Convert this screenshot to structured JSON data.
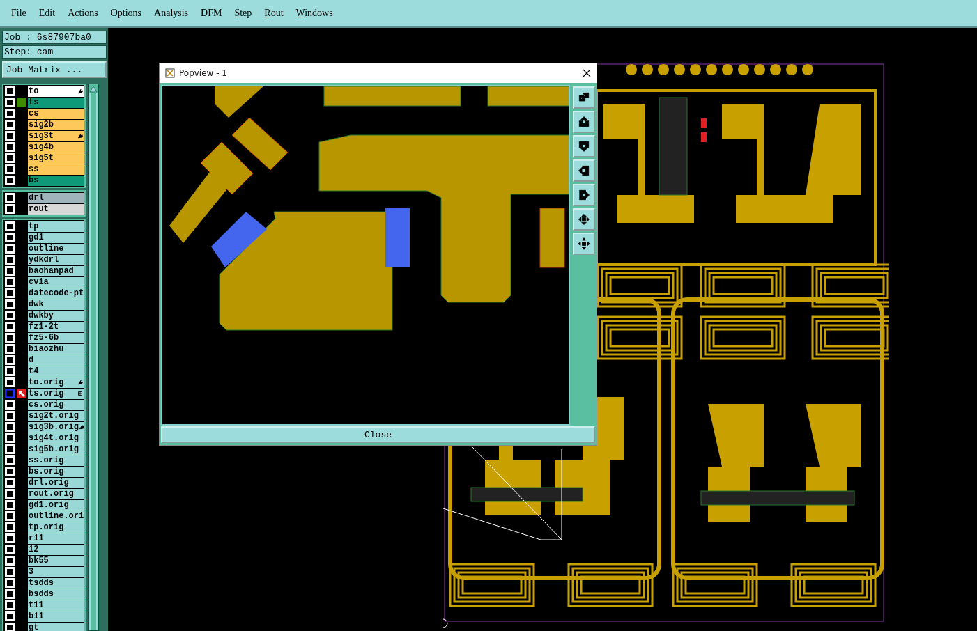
{
  "menu": [
    {
      "label": "File",
      "mnemonic": true
    },
    {
      "label": "Edit",
      "mnemonic": true
    },
    {
      "label": "Actions",
      "mnemonic": true
    },
    {
      "label": "Options",
      "mnemonic": false
    },
    {
      "label": "Analysis",
      "mnemonic": false
    },
    {
      "label": "DFM",
      "mnemonic": false
    },
    {
      "label": "Step",
      "mnemonic": true
    },
    {
      "label": "Rout",
      "mnemonic": true
    },
    {
      "label": "Windows",
      "mnemonic": true
    }
  ],
  "job": "Job : 6s87907ba0",
  "step": "Step: cam",
  "job_matrix_button": "Job Matrix ...",
  "layer_groups": [
    {
      "layers": [
        {
          "name": "to",
          "color": "#ffffff",
          "affected": true,
          "displayed": false,
          "work_layer": false
        },
        {
          "name": "ts",
          "color": "#0e9a78",
          "affected": false,
          "displayed": true,
          "work_layer": false
        },
        {
          "name": "cs",
          "color": "#ffc85a",
          "affected": false,
          "displayed": false,
          "work_layer": false
        },
        {
          "name": "sig2b",
          "color": "#ffc85a",
          "affected": false,
          "displayed": false,
          "work_layer": false
        },
        {
          "name": "sig3t",
          "color": "#ffc85a",
          "affected": true,
          "displayed": false,
          "work_layer": false
        },
        {
          "name": "sig4b",
          "color": "#ffc85a",
          "affected": false,
          "displayed": false,
          "work_layer": false
        },
        {
          "name": "sig5t",
          "color": "#ffc85a",
          "affected": false,
          "displayed": false,
          "work_layer": false
        },
        {
          "name": "ss",
          "color": "#ffc85a",
          "affected": false,
          "displayed": false,
          "work_layer": false
        },
        {
          "name": "bs",
          "color": "#0e9a78",
          "affected": false,
          "displayed": false,
          "work_layer": false
        }
      ]
    },
    {
      "layers": [
        {
          "name": "drl",
          "color": "#a0b4bc",
          "affected": false,
          "displayed": false,
          "work_layer": false
        },
        {
          "name": "rout",
          "color": "#d8d8d8",
          "affected": false,
          "displayed": false,
          "work_layer": false
        }
      ]
    },
    {
      "layers": [
        {
          "name": "tp",
          "color": "#9ad8d8",
          "affected": false,
          "displayed": false,
          "work_layer": false
        },
        {
          "name": "gd1",
          "color": "#9ad8d8",
          "affected": false,
          "displayed": false,
          "work_layer": false
        },
        {
          "name": "outline",
          "color": "#9ad8d8",
          "affected": false,
          "displayed": false,
          "work_layer": false
        },
        {
          "name": "ydkdrl",
          "color": "#9ad8d8",
          "affected": false,
          "displayed": false,
          "work_layer": false
        },
        {
          "name": "baohanpad",
          "color": "#9ad8d8",
          "affected": false,
          "displayed": false,
          "work_layer": false
        },
        {
          "name": "cvia",
          "color": "#9ad8d8",
          "affected": false,
          "displayed": false,
          "work_layer": false
        },
        {
          "name": "datecode-pt",
          "color": "#9ad8d8",
          "affected": false,
          "displayed": false,
          "work_layer": false
        },
        {
          "name": "dwk",
          "color": "#9ad8d8",
          "affected": false,
          "displayed": false,
          "work_layer": false
        },
        {
          "name": "dwkby",
          "color": "#9ad8d8",
          "affected": false,
          "displayed": false,
          "work_layer": false
        },
        {
          "name": "fz1-2t",
          "color": "#9ad8d8",
          "affected": false,
          "displayed": false,
          "work_layer": false
        },
        {
          "name": "fz5-6b",
          "color": "#9ad8d8",
          "affected": false,
          "displayed": false,
          "work_layer": false
        },
        {
          "name": "biaozhu",
          "color": "#9ad8d8",
          "affected": false,
          "displayed": false,
          "work_layer": false
        },
        {
          "name": "d",
          "color": "#9ad8d8",
          "affected": false,
          "displayed": false,
          "work_layer": false
        },
        {
          "name": "t4",
          "color": "#9ad8d8",
          "affected": false,
          "displayed": false,
          "work_layer": false
        },
        {
          "name": "to.orig",
          "color": "#9ad8d8",
          "affected": true,
          "displayed": false,
          "work_layer": false
        },
        {
          "name": "ts.orig",
          "color": "#9ad8d8",
          "affected": false,
          "displayed": false,
          "work_layer": true
        },
        {
          "name": "cs.orig",
          "color": "#9ad8d8",
          "affected": false,
          "displayed": false,
          "work_layer": false
        },
        {
          "name": "sig2t.orig",
          "color": "#9ad8d8",
          "affected": false,
          "displayed": false,
          "work_layer": false
        },
        {
          "name": "sig3b.orig",
          "color": "#9ad8d8",
          "affected": true,
          "displayed": false,
          "work_layer": false
        },
        {
          "name": "sig4t.orig",
          "color": "#9ad8d8",
          "affected": false,
          "displayed": false,
          "work_layer": false
        },
        {
          "name": "sig5b.orig",
          "color": "#9ad8d8",
          "affected": false,
          "displayed": false,
          "work_layer": false
        },
        {
          "name": "ss.orig",
          "color": "#9ad8d8",
          "affected": false,
          "displayed": false,
          "work_layer": false
        },
        {
          "name": "bs.orig",
          "color": "#9ad8d8",
          "affected": false,
          "displayed": false,
          "work_layer": false
        },
        {
          "name": "drl.orig",
          "color": "#9ad8d8",
          "affected": false,
          "displayed": false,
          "work_layer": false
        },
        {
          "name": "rout.orig",
          "color": "#9ad8d8",
          "affected": false,
          "displayed": false,
          "work_layer": false
        },
        {
          "name": "gd1.orig",
          "color": "#9ad8d8",
          "affected": false,
          "displayed": false,
          "work_layer": false
        },
        {
          "name": "outline.ori",
          "color": "#9ad8d8",
          "affected": false,
          "displayed": false,
          "work_layer": false
        },
        {
          "name": "tp.orig",
          "color": "#9ad8d8",
          "affected": false,
          "displayed": false,
          "work_layer": false
        },
        {
          "name": "r11",
          "color": "#9ad8d8",
          "affected": false,
          "displayed": false,
          "work_layer": false
        },
        {
          "name": "12",
          "color": "#9ad8d8",
          "affected": false,
          "displayed": false,
          "work_layer": false
        },
        {
          "name": "bk55",
          "color": "#9ad8d8",
          "affected": false,
          "displayed": false,
          "work_layer": false
        },
        {
          "name": "3",
          "color": "#9ad8d8",
          "affected": false,
          "displayed": false,
          "work_layer": false
        },
        {
          "name": "tsdds",
          "color": "#9ad8d8",
          "affected": false,
          "displayed": false,
          "work_layer": false
        },
        {
          "name": "bsdds",
          "color": "#9ad8d8",
          "affected": false,
          "displayed": false,
          "work_layer": false
        },
        {
          "name": "t11",
          "color": "#9ad8d8",
          "affected": false,
          "displayed": false,
          "work_layer": false
        },
        {
          "name": "b11",
          "color": "#9ad8d8",
          "affected": false,
          "displayed": false,
          "work_layer": false
        },
        {
          "name": "gt",
          "color": "#9ad8d8",
          "affected": false,
          "displayed": false,
          "work_layer": false
        }
      ]
    }
  ],
  "popview": {
    "title": "Popview - 1",
    "close_button": "Close"
  }
}
